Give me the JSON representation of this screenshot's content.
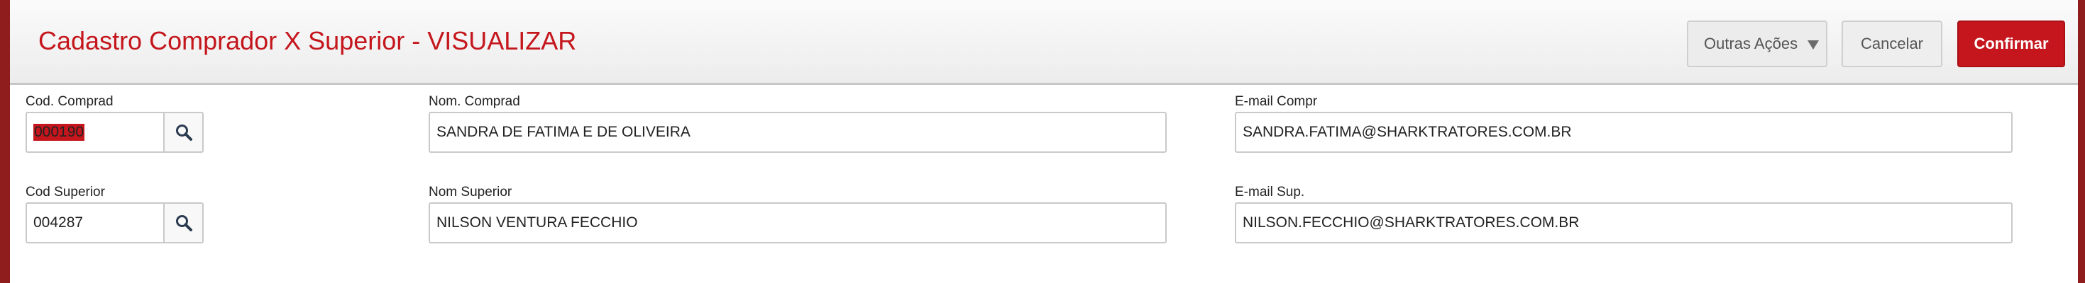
{
  "header": {
    "title": "Cadastro Comprador X Superior - VISUALIZAR",
    "buttons": {
      "outras": "Outras Ações",
      "cancel": "Cancelar",
      "confirm": "Confirmar"
    }
  },
  "form": {
    "cod_comprad": {
      "label": "Cod. Comprad",
      "value": "000190"
    },
    "nom_comprad": {
      "label": "Nom. Comprad",
      "value": "SANDRA DE FATIMA E DE OLIVEIRA"
    },
    "email_compr": {
      "label": "E-mail Compr",
      "value": "SANDRA.FATIMA@SHARKTRATORES.COM.BR"
    },
    "cod_superior": {
      "label": "Cod Superior",
      "value": "004287"
    },
    "nom_superior": {
      "label": "Nom Superior",
      "value": "NILSON VENTURA FECCHIO"
    },
    "email_sup": {
      "label": "E-mail Sup.",
      "value": "NILSON.FECCHIO@SHARKTRATORES.COM.BR"
    }
  },
  "colors": {
    "accent": "#c4161c",
    "frame": "#8f1d1d"
  },
  "icons": {
    "lookup": "search-icon",
    "dropdown": "caret-down-icon"
  }
}
